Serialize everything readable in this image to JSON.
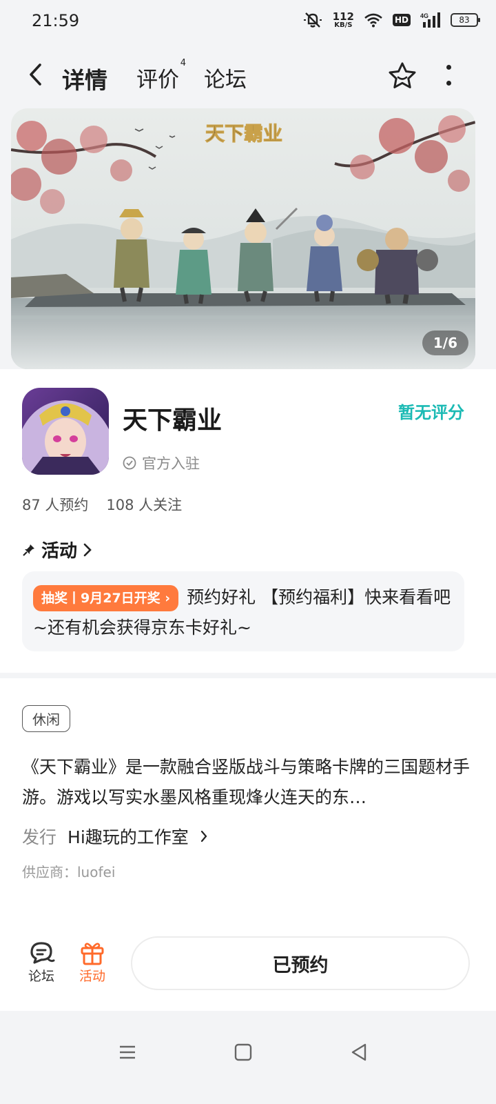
{
  "status_bar": {
    "time": "21:59",
    "net_speed": "112",
    "net_unit": "KB/S",
    "hd": "HD",
    "signal_label": "4G",
    "battery": "83"
  },
  "nav": {
    "tabs": [
      {
        "label": "详情",
        "active": true
      },
      {
        "label": "评价",
        "count": "4"
      },
      {
        "label": "论坛"
      }
    ]
  },
  "banner": {
    "title_art": "天下霸业",
    "counter": "1/6"
  },
  "app": {
    "name": "天下霸业",
    "official_label": "官方入驻",
    "rating": "暂无评分",
    "reservations": "87 人预约",
    "followers": "108 人关注"
  },
  "activity": {
    "heading": "活动",
    "badge": "抽奖丨9月27日开奖",
    "text": "预约好礼 【预约福利】快来看看吧~还有机会获得京东卡好礼~"
  },
  "details": {
    "tag": "休闲",
    "description": "《天下霸业》是一款融合竖版战斗与策略卡牌的三国题材手游。游戏以写实水墨风格重现烽火连天的东…",
    "publisher_label": "发行",
    "publisher_value": "Hi趣玩的工作室",
    "supplier": "供应商：luofei"
  },
  "bottom_bar": {
    "forum_label": "论坛",
    "activity_label": "活动",
    "reserve_button": "已预约"
  },
  "colors": {
    "accent_teal": "#1bc6c0",
    "accent_orange": "#ff7a3d"
  }
}
